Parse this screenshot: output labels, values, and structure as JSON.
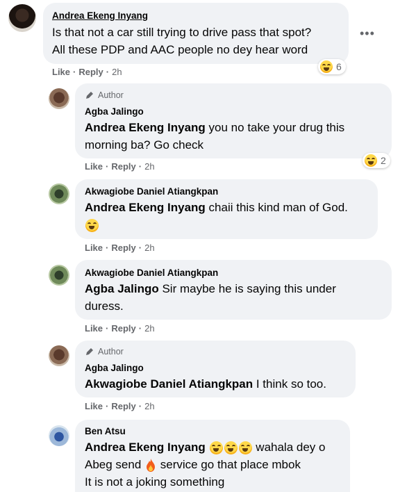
{
  "comment_main": {
    "author": "Andrea Ekeng Inyang",
    "text_line1": "Is that not a car still trying to drive pass that spot?",
    "text_line2": "All these PDP and AAC people no dey hear word",
    "like": "Like",
    "reply": "Reply",
    "time": "2h",
    "reaction_count": "6"
  },
  "replies": [
    {
      "badge": "Author",
      "author": "Agba Jalingo",
      "mention": "Andrea Ekeng Inyang",
      "text_line1": " you no take your drug this",
      "text_line2": "morning ba? Go check",
      "like": "Like",
      "reply": "Reply",
      "time": "2h",
      "reaction_count": "2"
    },
    {
      "author": "Akwagiobe Daniel Atiangkpan",
      "mention": "Andrea Ekeng Inyang",
      "text_line1": " chaii this kind man of God.",
      "like": "Like",
      "reply": "Reply",
      "time": "2h"
    },
    {
      "author": "Akwagiobe Daniel Atiangkpan",
      "mention": "Agba Jalingo",
      "text_line1": " Sir maybe he is saying this under",
      "text_line2": "duress.",
      "like": "Like",
      "reply": "Reply",
      "time": "2h"
    },
    {
      "badge": "Author",
      "author": "Agba Jalingo",
      "mention": "Akwagiobe Daniel Atiangkpan",
      "text_line1": " I think so too.",
      "like": "Like",
      "reply": "Reply",
      "time": "2h"
    },
    {
      "author": "Ben Atsu",
      "mention": "Andrea Ekeng Inyang",
      "text_line1_after": " wahala dey o",
      "text_line2_before": "Abeg send ",
      "text_line2_after": " service go that place mbok",
      "text_line3": "It is not a joking something"
    }
  ],
  "sep": "·",
  "colors": {
    "bubble": "#f0f2f5",
    "meta": "#65676b",
    "text": "#050505"
  },
  "icons": {
    "badge": "pencil-icon",
    "reaction": "laughing-emoji",
    "fire": "fire-emoji"
  }
}
